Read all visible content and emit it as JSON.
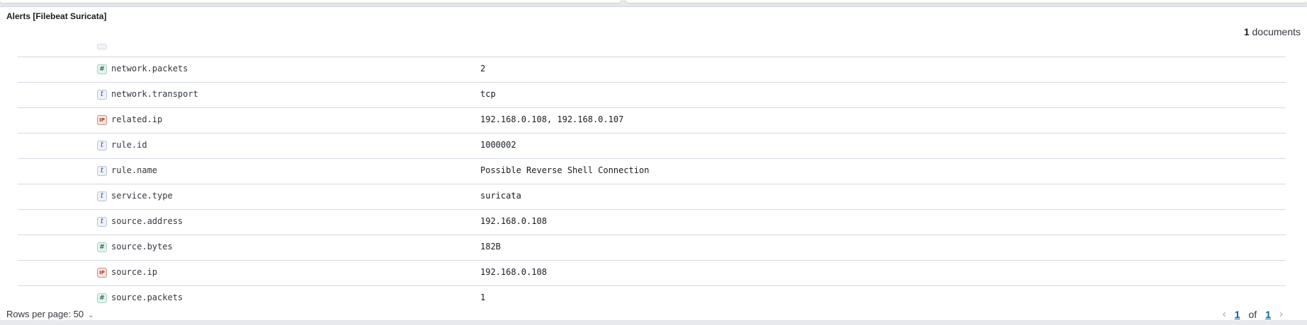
{
  "panel": {
    "title": "Alerts [Filebeat Suricata]",
    "doc_count_number": "1",
    "doc_count_label": " documents"
  },
  "rows": [
    {
      "type": "blank",
      "name": "",
      "value": ""
    },
    {
      "type": "number",
      "icon_glyph": "#",
      "name": "network.packets",
      "value": "2"
    },
    {
      "type": "string",
      "icon_glyph": "t",
      "name": "network.transport",
      "value": "tcp"
    },
    {
      "type": "ip",
      "icon_glyph": "IP",
      "name": "related.ip",
      "value": "192.168.0.108, 192.168.0.107"
    },
    {
      "type": "string",
      "icon_glyph": "t",
      "name": "rule.id",
      "value": "1000002"
    },
    {
      "type": "string",
      "icon_glyph": "t",
      "name": "rule.name",
      "value": "Possible Reverse Shell Connection"
    },
    {
      "type": "string",
      "icon_glyph": "t",
      "name": "service.type",
      "value": "suricata"
    },
    {
      "type": "string",
      "icon_glyph": "t",
      "name": "source.address",
      "value": "192.168.0.108"
    },
    {
      "type": "number",
      "icon_glyph": "#",
      "name": "source.bytes",
      "value": "182B"
    },
    {
      "type": "ip",
      "icon_glyph": "IP",
      "name": "source.ip",
      "value": "192.168.0.108"
    },
    {
      "type": "number",
      "icon_glyph": "#",
      "name": "source.packets",
      "value": "1"
    }
  ],
  "footer": {
    "rows_per_page_label": "Rows per page: 50",
    "current_page": "1",
    "of_label": "of",
    "total_pages": "1"
  },
  "icons": {
    "rows_per_page_chevron": "chevron-down-icon",
    "prev": "arrow-left-icon",
    "next": "arrow-right-icon"
  }
}
